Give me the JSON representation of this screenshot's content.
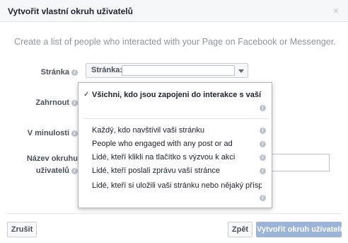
{
  "dialog": {
    "title": "Vytvořit vlastní okruh uživatelů",
    "close_icon": "×"
  },
  "intro": "Create a list of people who interacted with your Page on Facebook or Messenger.",
  "form": {
    "page_label": "Stránka",
    "page_select_label": "Stránka:",
    "include_label": "Zahrnout",
    "past_label": "V minulosti",
    "name_label_line1": "Název okruhu",
    "name_label_line2": "uživatelů",
    "info_glyph": "i"
  },
  "dropdown": {
    "selected_check": "✓",
    "items": [
      {
        "label": "Všichni, kdo jsou zapojeni do interakce s vaší stránkou",
        "selected": true
      },
      {
        "label": "Každý, kdo navštívil vaši stránku",
        "selected": false
      },
      {
        "label": "People who engaged with any post or ad",
        "selected": false
      },
      {
        "label": "Lidé, kteří klikli na tlačítko s výzvou k akci",
        "selected": false
      },
      {
        "label": "Lidé, kteří poslali zprávu vaší stránce",
        "selected": false
      },
      {
        "label": "Lidé, kteří si uložili vaši stránku nebo nějaký příspěvek",
        "selected": false
      }
    ]
  },
  "footer": {
    "cancel_label": "Zrušit",
    "back_label": "Zpět",
    "create_label": "Vytvořit okruh uživatelů"
  },
  "colors": {
    "header_bg": "#f6f7f9",
    "primary_disabled": "#9cb4d8",
    "info_icon": "#bec2c9"
  }
}
